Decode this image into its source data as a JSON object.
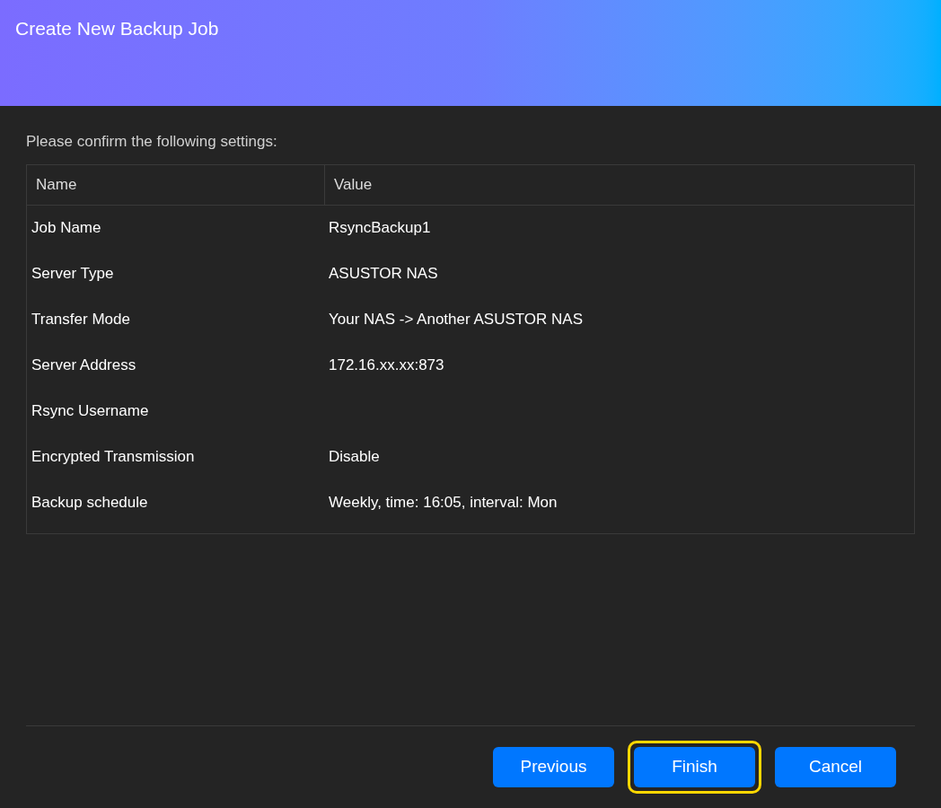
{
  "window": {
    "title": "Create New Backup Job"
  },
  "prompt": "Please confirm the following settings:",
  "table": {
    "columns": [
      "Name",
      "Value"
    ],
    "rows": [
      {
        "name": "Job Name",
        "value": "RsyncBackup1"
      },
      {
        "name": "Server Type",
        "value": "ASUSTOR NAS"
      },
      {
        "name": "Transfer Mode",
        "value": "Your NAS -> Another ASUSTOR NAS"
      },
      {
        "name": "Server Address",
        "value": "172.16.xx.xx:873"
      },
      {
        "name": "Rsync Username"
      },
      {
        "name": "Encrypted Transmission",
        "value": "Disable"
      },
      {
        "name": "Backup schedule",
        "value": "Weekly, time: 16:05, interval: Mon"
      }
    ]
  },
  "buttons": [
    {
      "label": "Previous",
      "highlighted": false
    },
    {
      "label": "Finish",
      "highlighted": true
    },
    {
      "label": "Cancel",
      "highlighted": false
    }
  ]
}
